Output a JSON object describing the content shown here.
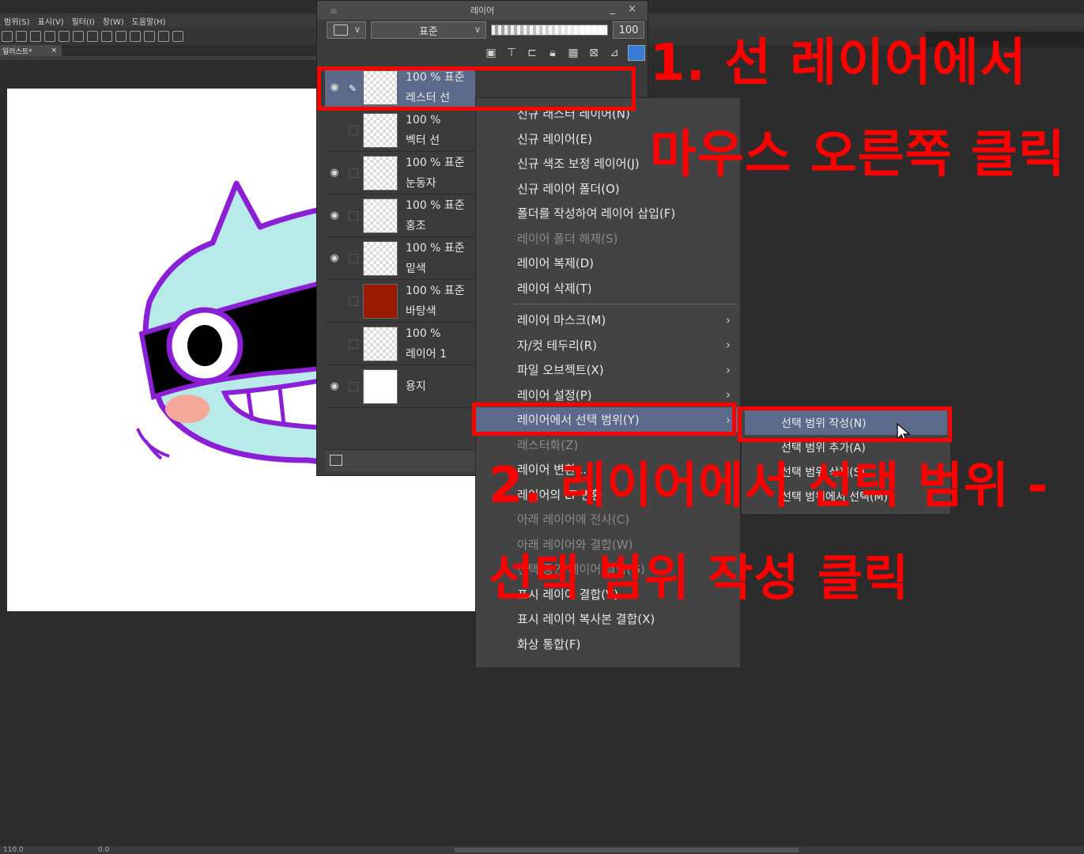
{
  "menubar": {
    "items": [
      "범위(S)",
      "표시(V)",
      "필터(I)",
      "창(W)",
      "도움말(H)"
    ]
  },
  "document_tab": {
    "label": "일러스트*",
    "close": "×"
  },
  "layer_panel": {
    "title": "레이어",
    "window_controls": "_ ×",
    "blend_mode": "표준",
    "opacity": "100",
    "layers": [
      {
        "pct": "100 % 표준",
        "name": "레스터 선",
        "visible": true,
        "selected": true,
        "thumb_color": "#f2e8ff"
      },
      {
        "pct": "100 %",
        "name": "벡터 선",
        "visible": false,
        "selected": false,
        "thumb_color": "#fde8e8"
      },
      {
        "pct": "100 % 표준",
        "name": "눈동자",
        "visible": true,
        "selected": false,
        "thumb_color": "#ffffff"
      },
      {
        "pct": "100 % 표준",
        "name": "홍조",
        "visible": true,
        "selected": false,
        "thumb_color": "#ffffff"
      },
      {
        "pct": "100 % 표준",
        "name": "밑색",
        "visible": true,
        "selected": false,
        "thumb_color": "#e6f6f8"
      },
      {
        "pct": "100 % 표준",
        "name": "바탕색",
        "visible": false,
        "selected": false,
        "thumb_color": "#9a1a00"
      },
      {
        "pct": "100 %",
        "name": "레이어 1",
        "visible": false,
        "selected": false,
        "thumb_color": "#e8eef8"
      },
      {
        "pct": "",
        "name": "용지",
        "visible": true,
        "selected": false,
        "thumb_color": "#ffffff"
      }
    ]
  },
  "context_menu": {
    "items": [
      {
        "label": "신규 래스터 레이어(N)",
        "disabled": false,
        "submenu": false
      },
      {
        "label": "신규 레이어(E)",
        "disabled": false,
        "submenu": false
      },
      {
        "label": "신규 색조 보정 레이어(J)",
        "disabled": false,
        "submenu": false
      },
      {
        "label": "신규 레이어 폴더(O)",
        "disabled": false,
        "submenu": false
      },
      {
        "label": "폴더를 작성하여 레이어 삽입(F)",
        "disabled": false,
        "submenu": false
      },
      {
        "label": "레이어 폴더 해제(S)",
        "disabled": true,
        "submenu": false
      },
      {
        "label": "레이어 복제(D)",
        "disabled": false,
        "submenu": false
      },
      {
        "label": "레이어 삭제(T)",
        "disabled": false,
        "submenu": false
      },
      {
        "label": "레이어 마스크(M)",
        "disabled": false,
        "submenu": true,
        "sep_before": true
      },
      {
        "label": "자/컷 테두리(R)",
        "disabled": false,
        "submenu": true
      },
      {
        "label": "파일 오브젝트(X)",
        "disabled": false,
        "submenu": true
      },
      {
        "label": "레이어 설정(P)",
        "disabled": false,
        "submenu": true
      },
      {
        "label": "레이어에서 선택 범위(Y)",
        "disabled": false,
        "submenu": true,
        "highlighted": true
      },
      {
        "label": "래스터화(Z)",
        "disabled": true,
        "submenu": false
      },
      {
        "label": "레이어 변환...",
        "disabled": false,
        "submenu": false
      },
      {
        "label": "레이어의 LT 변환",
        "disabled": false,
        "submenu": false
      },
      {
        "label": "아래 레이어에 전사(C)",
        "disabled": true,
        "submenu": false
      },
      {
        "label": "아래 레이어와 결합(W)",
        "disabled": true,
        "submenu": false
      },
      {
        "label": "선택 중인 레이어 결합(G)",
        "disabled": true,
        "submenu": false
      },
      {
        "label": "표시 레이어 결합(V)",
        "disabled": false,
        "submenu": false
      },
      {
        "label": "표시 레이어 복사본 결합(X)",
        "disabled": false,
        "submenu": false
      },
      {
        "label": "화상 통합(F)",
        "disabled": false,
        "submenu": false
      }
    ]
  },
  "submenu": {
    "items": [
      {
        "label": "선택 범위 작성(N)",
        "highlighted": true
      },
      {
        "label": "선택 범위 추가(A)",
        "highlighted": false
      },
      {
        "label": "선택 범위 삭제(S)",
        "highlighted": false
      },
      {
        "label": "선택 범위에서 선택(M)",
        "highlighted": false
      }
    ]
  },
  "annotations": {
    "step1_line1": "1. 선 레이어에서",
    "step1_line2": "마우스 오른쪽 클릭",
    "step2_line1": "2. 레이어에서 선택 범위 -",
    "step2_line2": "선택 범위 작성 클릭"
  },
  "status": {
    "zoom": "110.0",
    "angle": "0.0"
  },
  "colors": {
    "annotation_red": "#ff0000",
    "highlight": "#5b6a8a",
    "character_body": "#b9eaea",
    "character_outline": "#8a1fd6",
    "blush": "#f4a89a"
  }
}
